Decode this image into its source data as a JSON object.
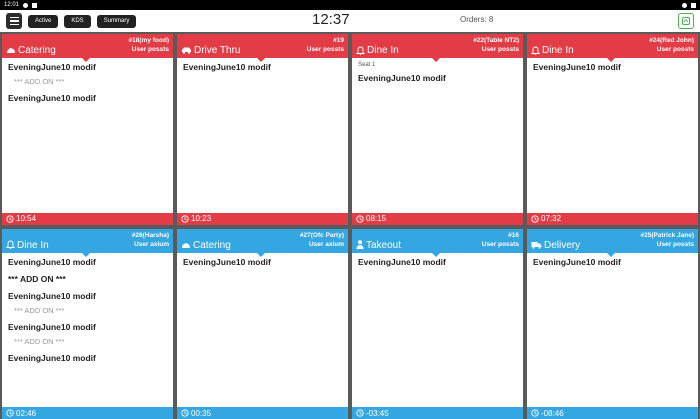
{
  "statusbar": {
    "time": "12:01"
  },
  "toolbar": {
    "buttons": [
      "Active",
      "KDS",
      "Summary"
    ],
    "clock": "12:37",
    "orders": "Orders: 8"
  },
  "colors": {
    "red": "#e23c47",
    "blue": "#34a7e2"
  },
  "cards": [
    {
      "color": "red",
      "icon": "cloud-icon",
      "type": "Catering",
      "ticket": "#18(my food)",
      "server": "User possts",
      "seat": "",
      "lines": [
        {
          "kind": "item",
          "text": "EveningJune10 modif"
        },
        {
          "kind": "addon",
          "text": "*** ADD ON ***"
        },
        {
          "kind": "item",
          "text": "EveningJune10 modif"
        }
      ],
      "timer": "10:54"
    },
    {
      "color": "red",
      "icon": "car-icon",
      "type": "Drive Thru",
      "ticket": "#19",
      "server": "User possts",
      "seat": "",
      "lines": [
        {
          "kind": "item",
          "text": "EveningJune10 modif"
        }
      ],
      "timer": "10:23"
    },
    {
      "color": "red",
      "icon": "bell-icon",
      "type": "Dine In",
      "ticket": "#22(Table NT2)",
      "server": "User possts",
      "seat": "Seat 1",
      "lines": [
        {
          "kind": "item",
          "text": "EveningJune10 modif"
        }
      ],
      "timer": "08:15"
    },
    {
      "color": "red",
      "icon": "bell-icon",
      "type": "Dine In",
      "ticket": "#24(Red John)",
      "server": "User possts",
      "seat": "",
      "lines": [
        {
          "kind": "item",
          "text": "EveningJune10 modif"
        }
      ],
      "timer": "07:32"
    },
    {
      "color": "blue",
      "icon": "bell-icon",
      "type": "Dine In",
      "ticket": "#26(Harsha)",
      "server": "User axium",
      "seat": "",
      "lines": [
        {
          "kind": "item",
          "text": "EveningJune10 modif"
        },
        {
          "kind": "item",
          "text": "*** ADD ON ***"
        },
        {
          "kind": "item",
          "text": "EveningJune10 modif"
        },
        {
          "kind": "addon",
          "text": "*** ADD ON ***"
        },
        {
          "kind": "item",
          "text": "EveningJune10 modif"
        },
        {
          "kind": "addon",
          "text": "*** ADD ON ***"
        },
        {
          "kind": "item",
          "text": "EveningJune10 modif"
        }
      ],
      "timer": "02:46"
    },
    {
      "color": "blue",
      "icon": "cloud-icon",
      "type": "Catering",
      "ticket": "#27(Ofc Party)",
      "server": "User axium",
      "seat": "",
      "lines": [
        {
          "kind": "item",
          "text": "EveningJune10 modif"
        }
      ],
      "timer": "00:35"
    },
    {
      "color": "blue",
      "icon": "person-icon",
      "type": "Takeout",
      "ticket": "#16",
      "server": "User possts",
      "seat": "",
      "lines": [
        {
          "kind": "item",
          "text": "EveningJune10 modif"
        }
      ],
      "timer": "-03:45"
    },
    {
      "color": "blue",
      "icon": "truck-icon",
      "type": "Delivery",
      "ticket": "#25(Patrick Jane)",
      "server": "User possts",
      "seat": "",
      "lines": [
        {
          "kind": "item",
          "text": "EveningJune10 modif"
        }
      ],
      "timer": "-08:46"
    }
  ]
}
